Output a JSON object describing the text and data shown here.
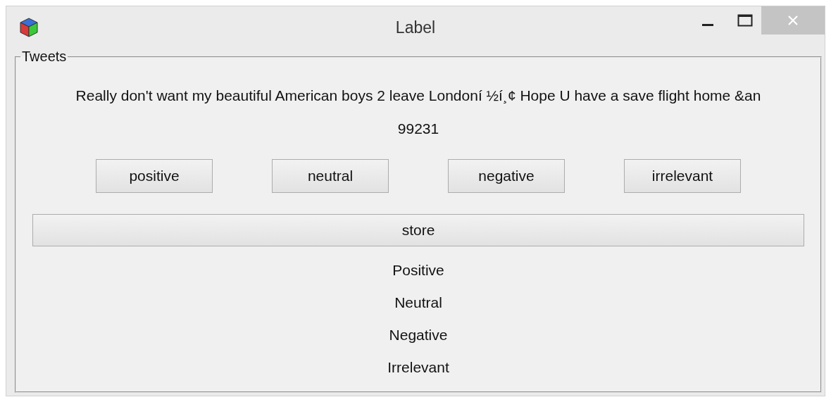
{
  "window": {
    "title": "Label"
  },
  "group": {
    "title": "Tweets",
    "tweet": "Really don't want my beautiful American boys 2 leave Londoní ½í¸¢ Hope U have a save flight home &an",
    "id": "99231",
    "buttons": [
      "positive",
      "neutral",
      "negative",
      "irrelevant"
    ],
    "store_button": "store",
    "labels": [
      "Positive",
      "Neutral",
      "Negative",
      "Irrelevant"
    ]
  }
}
